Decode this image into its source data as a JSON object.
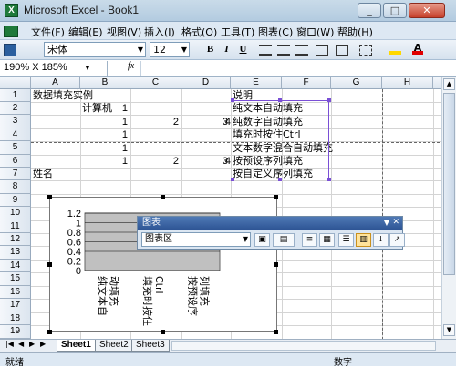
{
  "window": {
    "title": "Microsoft Excel - Book1",
    "app_icon": "X",
    "minimize": "_",
    "maximize": "□",
    "close": "✕"
  },
  "menu": {
    "items": [
      "文件(F)",
      "编辑(E)",
      "视图(V)",
      "插入(I)",
      "格式(O)",
      "工具(T)",
      "图表(C)",
      "窗口(W)",
      "帮助(H)"
    ]
  },
  "toolbar": {
    "font_name": "宋体",
    "font_size": "12",
    "bold": "B",
    "italic": "I",
    "underline": "U"
  },
  "formula": {
    "namebox": "190% X 185%",
    "fx": "fx"
  },
  "columns": [
    "A",
    "B",
    "C",
    "D",
    "E",
    "F",
    "G",
    "H"
  ],
  "rows": [
    "1",
    "2",
    "3",
    "4",
    "5",
    "6",
    "7",
    "8",
    "9",
    "10",
    "11",
    "12",
    "13",
    "14",
    "15",
    "16",
    "17",
    "18",
    "19"
  ],
  "cells": {
    "A1": "数据填充实例",
    "E1": "说明",
    "B2": "1",
    "C2": "计算机",
    "B3": "1",
    "C3": "2",
    "D3": "3",
    "E3num": "4",
    "E2": "纯文本自动填充",
    "E3": "纯数字自动填充",
    "B4": "1",
    "E4": "填充时按住Ctrl",
    "B5": "1",
    "E5": "文本数字混合自动填充",
    "B6": "1",
    "C6": "2",
    "D6": "3",
    "E6num": "4",
    "E6": "按预设序列填充",
    "A7": "姓名",
    "E7": "按自定义序列填充"
  },
  "chart_data": {
    "type": "bar",
    "categories": [
      "纯文本自动填充",
      "填充时按住Ctrl",
      "按预设序列填充"
    ],
    "values": [
      0,
      0,
      0
    ],
    "title": "",
    "xlabel": "",
    "ylabel": "",
    "ylim": [
      0,
      1.2
    ],
    "yticks": [
      "1.2",
      "1",
      "0.8",
      "0.6",
      "0.4",
      "0.2",
      "0"
    ],
    "plot_area_color": "#c0c0c0",
    "grid": true,
    "legend": "none"
  },
  "chart_panel": {
    "title": "图表",
    "object_select": "图表区"
  },
  "sheets": [
    "Sheet1",
    "Sheet2",
    "Sheet3"
  ],
  "status": {
    "ready": "就绪",
    "mode": "数字"
  }
}
